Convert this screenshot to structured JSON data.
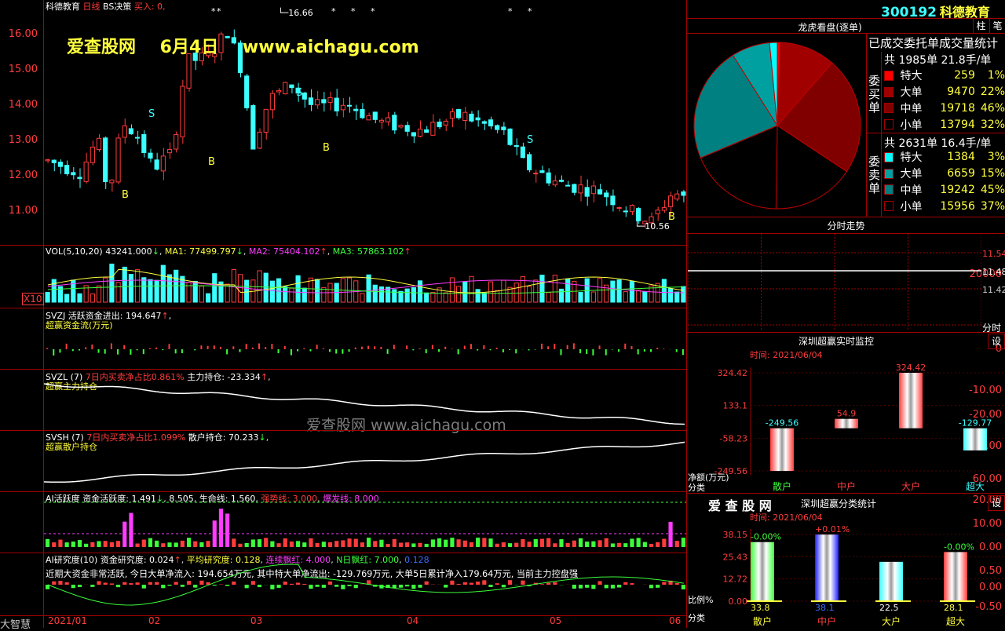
{
  "header": {
    "stock_name": "科德教育",
    "period": "日线",
    "indicator": "BS决策",
    "buy_signal": "买入: 0,",
    "code": "300192",
    "name": "科德教育",
    "btn_zhu": "柱",
    "btn_bi": "笔"
  },
  "watermark": {
    "site": "爱查股网",
    "date": "6月4日",
    "url": "www.aichagu.com",
    "faint": "爱查股网  www.aichagu.com"
  },
  "price_chart": {
    "high_label": "16.66",
    "low_label": "10.56",
    "y_ticks": [
      "16.00",
      "15.00",
      "14.00",
      "13.00",
      "12.00",
      "11.00"
    ]
  },
  "vol": {
    "title": "VOL(5,10,20)",
    "value": "43241.000",
    "ma1": "MA1: 77499.797",
    "ma2": "MA2: 75404.102",
    "ma3": "MA3: 57863.102",
    "tick": "20000",
    "unit": "X10"
  },
  "svzj": {
    "line1": "SVZJ  活跃资金进出: 194.647",
    "line2": "超赢资金流(万元)",
    "tick": "0"
  },
  "svzl": {
    "prefix": "SVZL (7)",
    "ratio": "7日内买卖净占比0.861%",
    "hold": "主力持仓: -23.334",
    "line2": "超赢主力持仓",
    "ticks": [
      "-10.00",
      "-20.00"
    ]
  },
  "svsh": {
    "prefix": "SVSH (7)",
    "ratio": "7日内买卖净占比1.099%",
    "hold": "散户持仓: 70.233",
    "line2": "超赢散户持仓",
    "ticks": [
      "70.00",
      "60.00"
    ]
  },
  "ai_active": {
    "label": "AI活跃度",
    "v1": "资金活跃度: 1.491",
    "v2": "8.505",
    "v3": "生命线: 1.560",
    "v4": "强势线: 3.000",
    "v5": "爆发线: 8.000",
    "ticks": [
      "20.00",
      "10.00",
      "0.00"
    ]
  },
  "ai_research": {
    "label": "AI研究度(10)",
    "v1": "资金研究度: 0.024",
    "v2": "平均研究度: 0.128",
    "v3": "连续飘红: 4.000",
    "v4": "N日飘红: 7.000",
    "v5": "0.128",
    "comment": "近期大资金非常活跃, 今日大单净流入: 194.654万元, 其中特大单净流出: -129.769万元, 大单5日累计净入179.64万元, 当前主力控盘强",
    "ticks": [
      "0.50",
      "0.00",
      "-0.50"
    ]
  },
  "x_axis": [
    "2021/01",
    "02",
    "03",
    "04",
    "05",
    "06"
  ],
  "bottom_left": "大智慧",
  "dragon": {
    "title": "龙虎看盘(逐单)",
    "subtitle": "已成交委托单成交量统计",
    "buy_side": "委买单",
    "sell_side": "委卖单",
    "buy_total": "共 1985单 21.8手/单",
    "sell_total": "共 2631单 16.4手/单",
    "buy_rows": [
      {
        "label": "特大",
        "count": "259",
        "pct": "1%",
        "color": "#ff0000"
      },
      {
        "label": "大单",
        "count": "9470",
        "pct": "22%",
        "color": "#a00000"
      },
      {
        "label": "中单",
        "count": "19718",
        "pct": "46%",
        "color": "#800000"
      },
      {
        "label": "小单",
        "count": "13794",
        "pct": "32%",
        "color": "#000000"
      }
    ],
    "sell_rows": [
      {
        "label": "特大",
        "count": "1384",
        "pct": "3%",
        "color": "#00ffff"
      },
      {
        "label": "大单",
        "count": "6659",
        "pct": "15%",
        "color": "#00a0a0"
      },
      {
        "label": "中单",
        "count": "19242",
        "pct": "45%",
        "color": "#008080"
      },
      {
        "label": "小单",
        "count": "15956",
        "pct": "37%",
        "color": "#000000"
      }
    ]
  },
  "intraday": {
    "title": "分时走势",
    "ticks": [
      "11.54",
      "11.48",
      "11.42"
    ],
    "unit": "分时"
  },
  "monitor": {
    "title": "深圳超赢实时监控",
    "btn": "设",
    "time": "时间: 2021/06/04",
    "y_ticks": [
      "324.42",
      "133.1",
      "-58.23",
      "-249.56"
    ],
    "axis_label": "净额(万元)",
    "cat_label": "分类",
    "categories": [
      "散户",
      "中户",
      "大户",
      "超大"
    ],
    "values": [
      "-249.56",
      "54.9",
      "324.42",
      "-129.77"
    ]
  },
  "classify": {
    "brand": "爱 查 股 网",
    "title": "深圳超赢分类统计",
    "btn": "设",
    "time": "时间: 2021/06/04",
    "y_ticks": [
      "38.15",
      "25.43",
      "12.72",
      "0.00"
    ],
    "axis_label": "比例%",
    "cat_label": "分类",
    "categories": [
      "散户",
      "中户",
      "大户",
      "超大"
    ],
    "values": [
      "33.8",
      "38.1",
      "22.5",
      "28.1"
    ],
    "changes": [
      "-0.00%",
      "+0.01%",
      "",
      "-0.00%"
    ]
  }
}
